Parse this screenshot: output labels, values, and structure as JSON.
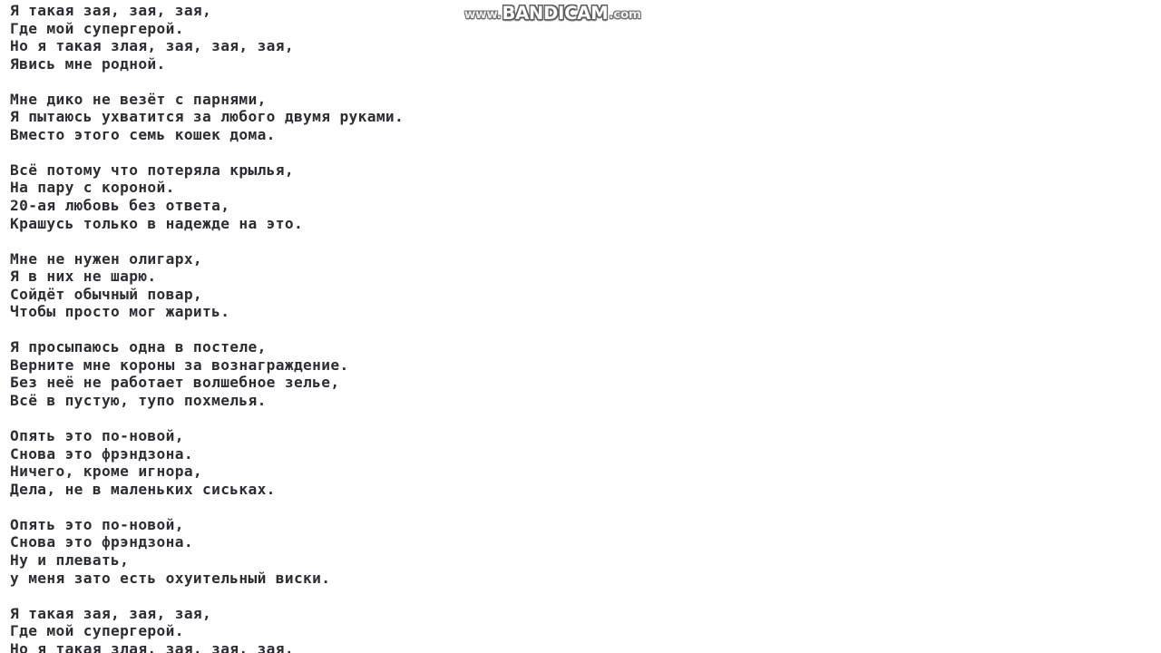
{
  "page": {
    "background_color": "#ffffff",
    "text_color": "#2c2c34",
    "type": "song-lyrics-video-frame"
  },
  "watermark": {
    "name": "bandicam-watermark",
    "prefix": "www.",
    "brand": "BANDICAM",
    "suffix": ".com",
    "full_text": "www.BANDICAM.com",
    "brand_color": "#ffffff",
    "small_color": "#efefef",
    "outline_color": "#5d5d5d"
  },
  "lyrics": {
    "stanzas": [
      {
        "lines": [
          "Я такая зая, зая, зая,",
          "Где мой супергерой.",
          "Но я такая злая, зая, зая, зая,",
          "Явись мне родной."
        ]
      },
      {
        "lines": [
          "Мне дико не везёт с парнями,",
          "Я пытаюсь ухватится за любого двумя руками.",
          "Вместо этого семь кошек дома."
        ]
      },
      {
        "lines": [
          "Всё потому что потеряла крылья,",
          "На пару с короной.",
          "20-ая любовь без ответа,",
          "Крашусь только в надежде на это."
        ]
      },
      {
        "lines": [
          "Мне не нужен олигарх,",
          "Я в них не шарю.",
          "Сойдёт обычный повар,",
          "Чтобы просто мог жарить."
        ]
      },
      {
        "lines": [
          "Я просыпаюсь одна в постеле,",
          "Верните мне короны за вознаграждение.",
          "Без неё не работает волшебное зелье,",
          "Всё в пустую, тупо похмелья."
        ]
      },
      {
        "lines": [
          "Опять это по-новой,",
          "Снова это фрэндзона.",
          "Ничего, кроме игнора,",
          "Дела, не в маленьких сиськах."
        ]
      },
      {
        "lines": [
          "Опять это по-новой,",
          "Снова это фрэндзона.",
          "Ну и плевать,",
          "у меня зато есть охуительный виски."
        ]
      },
      {
        "lines": [
          "Я такая зая, зая, зая,",
          "Где мой супергерой.",
          "Но я такая злая, зая, зая, зая,"
        ]
      }
    ]
  }
}
